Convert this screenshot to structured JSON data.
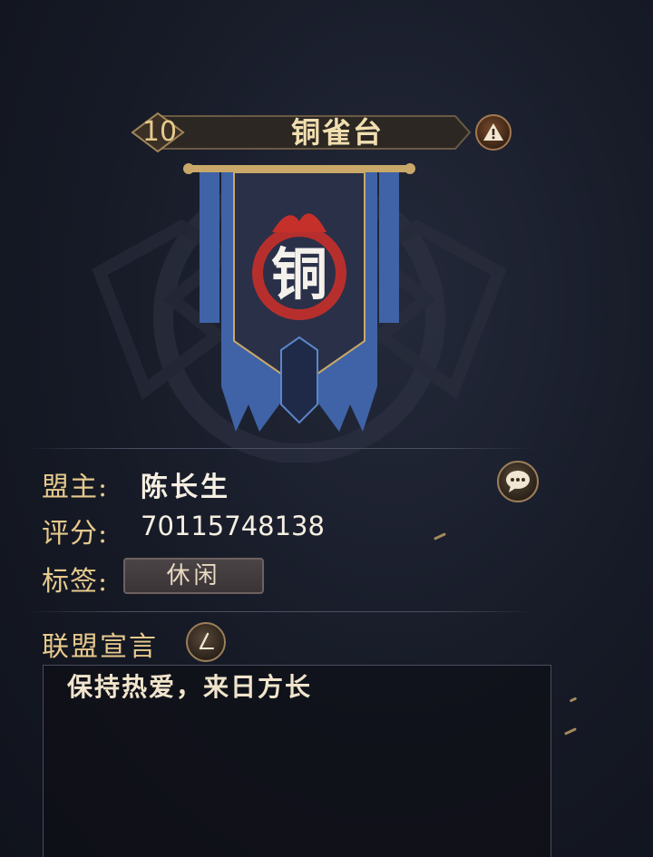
{
  "alliance": {
    "level": "10",
    "name": "铜雀台",
    "banner_glyph": "铜"
  },
  "info": {
    "leader_label": "盟主:",
    "leader_value": "陈长生",
    "score_label": "评分:",
    "score_value": "70115748138",
    "tag_label": "标签:",
    "tag_value": "休闲"
  },
  "declaration": {
    "title": "联盟宣言",
    "text": "保持热爱，来日方长"
  },
  "icons": {
    "warn": "warning-icon",
    "chat": "chat-bubble-icon",
    "edit": "pen-edit-icon"
  },
  "colors": {
    "gold": "#e6c98c",
    "banner_blue": "#3f63a6",
    "flame_red": "#c6302a"
  }
}
